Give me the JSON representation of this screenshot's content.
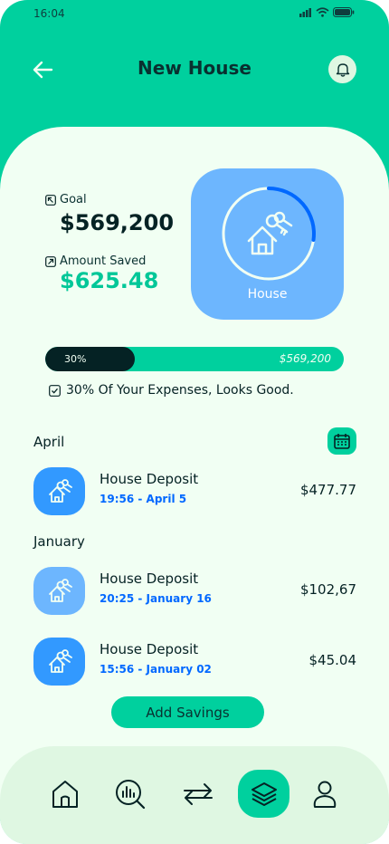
{
  "status": {
    "time": "16:04"
  },
  "header": {
    "title": "New House"
  },
  "summary": {
    "goal_label": "Goal",
    "goal_value": "$569,200",
    "saved_label": "Amount Saved",
    "saved_value": "$625.48",
    "category_label": "House",
    "progress_percent": 30,
    "progress_label": "30%",
    "progress_goal": "$569,200",
    "note": "30% Of Your Expenses, Looks Good."
  },
  "groups": [
    {
      "month": "April",
      "transactions": [
        {
          "title": "House Deposit",
          "date": "19:56 - April 5",
          "amount": "$477.77"
        }
      ]
    },
    {
      "month": "January",
      "transactions": [
        {
          "title": "House Deposit",
          "date": "20:25 - January 16",
          "amount": "$102,67"
        },
        {
          "title": "House Deposit",
          "date": "15:56 - January 02",
          "amount": "$45.04"
        }
      ]
    }
  ],
  "actions": {
    "add_savings": "Add Savings"
  },
  "nav": [
    {
      "icon": "home-icon",
      "active": false
    },
    {
      "icon": "analysis-icon",
      "active": false
    },
    {
      "icon": "transactions-icon",
      "active": false
    },
    {
      "icon": "categories-icon",
      "active": true
    },
    {
      "icon": "profile-icon",
      "active": false
    }
  ],
  "colors": {
    "primary": "#00d09e",
    "background": "#f1fff3",
    "dark": "#052224",
    "card_blue": "#6db6fe",
    "deep_blue": "#3299ff",
    "link_blue": "#0068ff"
  }
}
